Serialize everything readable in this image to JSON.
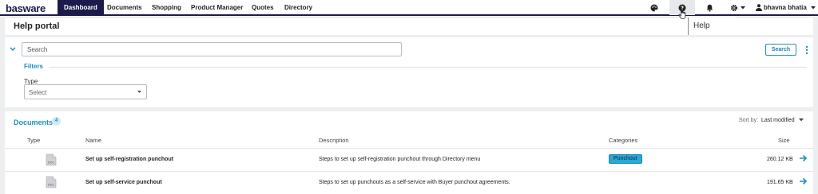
{
  "nav": {
    "logo": "basware",
    "items": [
      "Dashboard",
      "Documents",
      "Shopping",
      "Product Manager",
      "Quotes",
      "Directory"
    ],
    "user_name": "bhavna bhatia",
    "help_tooltip": "Help"
  },
  "page": {
    "title": "Help portal"
  },
  "search": {
    "placeholder": "Search",
    "button_label": "Search",
    "filters_label": "Filters",
    "type_label": "Type",
    "type_select": "Select"
  },
  "documents": {
    "title": "Documents",
    "count": "4",
    "sort_label": "Sort by:",
    "sort_value": "Last modified",
    "columns": {
      "type": "Type",
      "name": "Name",
      "description": "Description",
      "categories": "Categories",
      "size": "Size"
    },
    "rows": [
      {
        "type_icon": "doc-file-icon",
        "type_text": "DOC",
        "name": "Set up self-registration punchout",
        "description": "Steps to set up self-registration punchout through Directory menu",
        "category": "Punchout",
        "size": "260.12 KB"
      },
      {
        "type_icon": "doc-file-icon",
        "type_text": "DOC",
        "name": "Set up self-service punchout",
        "description": "Steps to set up punchouts as a self-service with Buyer punchout agreements.",
        "category": "",
        "size": "191.65 KB"
      }
    ]
  },
  "colors": {
    "brand_navy": "#1b1a4a",
    "accent_blue": "#1f8fbf",
    "badge_blue": "#2aa7d6"
  }
}
